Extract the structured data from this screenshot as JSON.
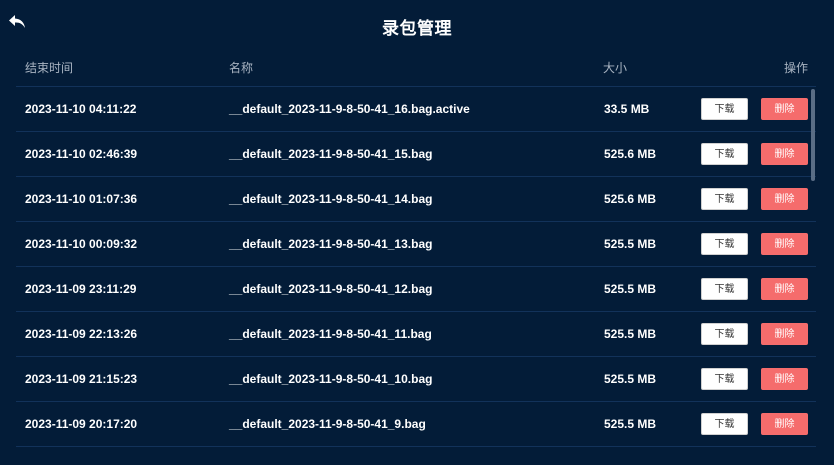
{
  "header": {
    "title": "录包管理",
    "back_icon": "back-arrow-icon"
  },
  "table": {
    "columns": {
      "end_time": "结束时间",
      "name": "名称",
      "size": "大小",
      "operation": "操作"
    },
    "actions": {
      "download": "下载",
      "delete": "删除"
    },
    "rows": [
      {
        "time": "2023-11-10 04:11:22",
        "name": "__default_2023-11-9-8-50-41_16.bag.active",
        "size": "33.5 MB"
      },
      {
        "time": "2023-11-10 02:46:39",
        "name": "__default_2023-11-9-8-50-41_15.bag",
        "size": "525.6 MB"
      },
      {
        "time": "2023-11-10 01:07:36",
        "name": "__default_2023-11-9-8-50-41_14.bag",
        "size": "525.6 MB"
      },
      {
        "time": "2023-11-10 00:09:32",
        "name": "__default_2023-11-9-8-50-41_13.bag",
        "size": "525.5 MB"
      },
      {
        "time": "2023-11-09 23:11:29",
        "name": "__default_2023-11-9-8-50-41_12.bag",
        "size": "525.5 MB"
      },
      {
        "time": "2023-11-09 22:13:26",
        "name": "__default_2023-11-9-8-50-41_11.bag",
        "size": "525.5 MB"
      },
      {
        "time": "2023-11-09 21:15:23",
        "name": "__default_2023-11-9-8-50-41_10.bag",
        "size": "525.5 MB"
      },
      {
        "time": "2023-11-09 20:17:20",
        "name": "__default_2023-11-9-8-50-41_9.bag",
        "size": "525.5 MB"
      }
    ]
  },
  "colors": {
    "background": "#031c38",
    "row_divider": "#12325a",
    "delete_button": "#f56c6c",
    "download_button": "#ffffff",
    "header_text": "#a9b4c2"
  }
}
